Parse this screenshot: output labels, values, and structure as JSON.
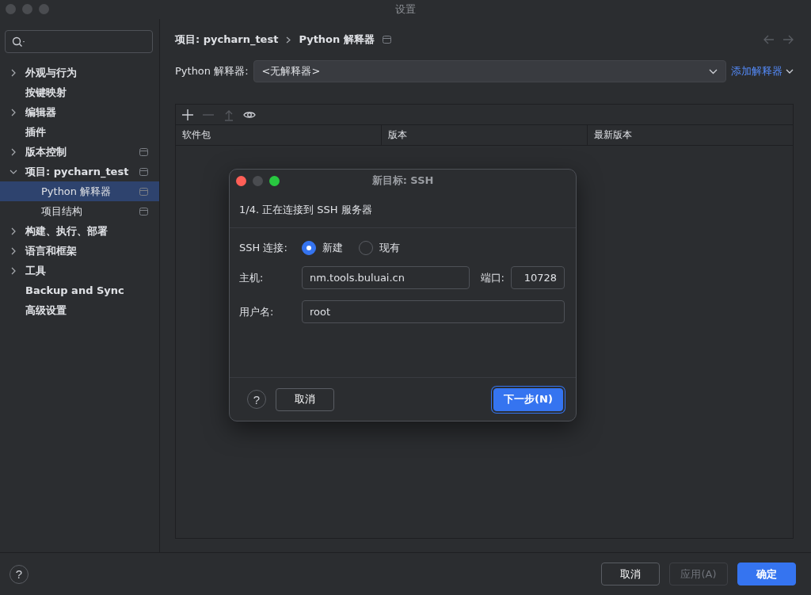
{
  "window": {
    "title": "设置"
  },
  "sidebar": {
    "items": [
      {
        "label": "外观与行为",
        "expanded": false,
        "selected": false,
        "scope_icon": false
      },
      {
        "label": "按键映射",
        "selected": false,
        "scope_icon": false
      },
      {
        "label": "编辑器",
        "expanded": false,
        "selected": false,
        "scope_icon": false
      },
      {
        "label": "插件",
        "selected": false,
        "scope_icon": false
      },
      {
        "label": "版本控制",
        "expanded": false,
        "selected": false,
        "scope_icon": true
      },
      {
        "label": "项目: pycharn_test",
        "expanded": true,
        "selected": false,
        "scope_icon": true,
        "children": [
          {
            "label": "Python 解释器",
            "selected": true,
            "scope_icon": true
          },
          {
            "label": "项目结构",
            "selected": false,
            "scope_icon": true
          }
        ]
      },
      {
        "label": "构建、执行、部署",
        "expanded": false,
        "selected": false,
        "scope_icon": false
      },
      {
        "label": "语言和框架",
        "expanded": false,
        "selected": false,
        "scope_icon": false
      },
      {
        "label": "工具",
        "expanded": false,
        "selected": false,
        "scope_icon": false
      },
      {
        "label": "Backup and Sync",
        "selected": false,
        "scope_icon": false
      },
      {
        "label": "高级设置",
        "selected": false,
        "scope_icon": false
      }
    ]
  },
  "breadcrumb": [
    "项目: pycharn_test",
    "Python 解释器"
  ],
  "interpreter": {
    "label": "Python 解释器:",
    "value": "<无解释器>",
    "add_link": "添加解释器"
  },
  "packages": {
    "toolbar": [
      {
        "kind": "add",
        "disabled": false
      },
      {
        "kind": "remove",
        "disabled": true
      },
      {
        "kind": "upgrade",
        "disabled": true
      },
      {
        "kind": "show",
        "disabled": false
      }
    ],
    "columns": [
      "软件包",
      "版本",
      "最新版本"
    ]
  },
  "dialog": {
    "title": "新目标: SSH",
    "step": "1/4. 正在连接到 SSH 服务器",
    "connection": {
      "label": "SSH 连接:",
      "options": [
        {
          "label": "新建",
          "selected": true
        },
        {
          "label": "现有",
          "selected": false
        }
      ]
    },
    "host": {
      "label": "主机:",
      "value": "nm.tools.buluai.cn"
    },
    "port": {
      "label": "端口:",
      "value": "10728"
    },
    "username": {
      "label": "用户名:",
      "value": "root"
    },
    "help": "?",
    "buttons": [
      {
        "label": "取消",
        "kind": "secondary"
      },
      {
        "label": "下一步(N)",
        "kind": "primary"
      }
    ]
  },
  "footer": {
    "help": "?",
    "buttons": [
      {
        "label": "取消",
        "kind": "secondary",
        "disabled": false
      },
      {
        "label": "应用(A)",
        "kind": "secondary",
        "disabled": true
      },
      {
        "label": "确定",
        "kind": "primary",
        "disabled": false
      }
    ]
  }
}
